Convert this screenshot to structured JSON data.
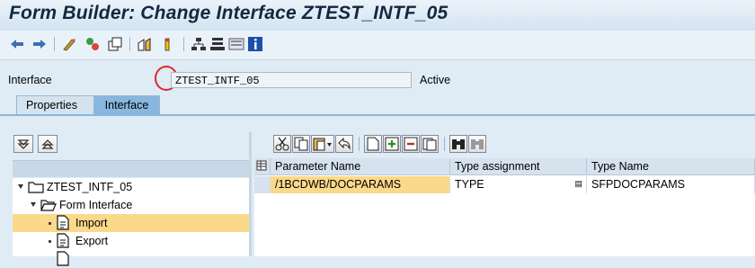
{
  "window": {
    "title": "Form Builder: Change Interface ZTEST_INTF_05"
  },
  "toolbar": {
    "buttons": [
      "back-icon",
      "forward-icon",
      "other-object-icon",
      "display-change-icon",
      "activate-icon",
      "test-icon",
      "check-icon",
      "where-used-icon",
      "hierarchy-icon",
      "layout-icon",
      "form-icon",
      "info-icon"
    ],
    "highlight_color": "#e0262b"
  },
  "interface": {
    "label": "Interface",
    "value": "ZTEST_INTF_05",
    "status": "Active"
  },
  "tabs": [
    {
      "label": "Properties",
      "active": false
    },
    {
      "label": "Interface",
      "active": true
    }
  ],
  "tree": {
    "nodes": [
      {
        "label": "ZTEST_INTF_05",
        "level": 0,
        "icon": "folder-icon",
        "expanded": true,
        "selected": false
      },
      {
        "label": "Form Interface",
        "level": 1,
        "icon": "folder-open-icon",
        "expanded": true,
        "selected": false
      },
      {
        "label": "Import",
        "level": 2,
        "icon": "document-icon",
        "selected": true
      },
      {
        "label": "Export",
        "level": 2,
        "icon": "document-icon",
        "selected": false
      }
    ]
  },
  "grid": {
    "columns": [
      "Parameter Name",
      "Type assignment",
      "Type Name"
    ],
    "rows": [
      {
        "param": "/1BCDWB/DOCPARAMS",
        "assignment": "TYPE",
        "type_name": "SFPDOCPARAMS"
      }
    ]
  },
  "colors": {
    "selection": "#fbd98a",
    "active_tab": "#87b7de"
  }
}
